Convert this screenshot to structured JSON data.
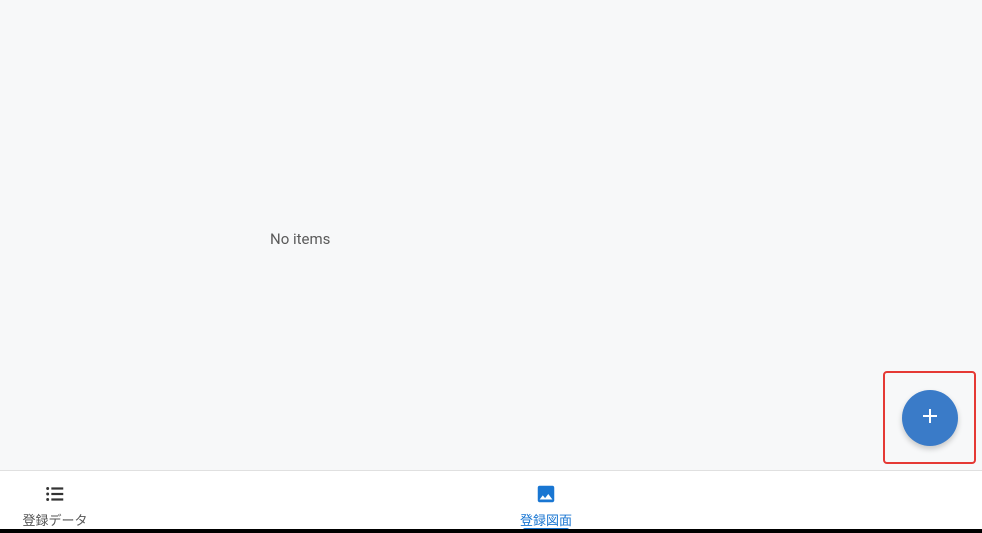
{
  "main": {
    "empty_message": "No items"
  },
  "fab": {
    "icon": "plus-icon",
    "highlighted": true
  },
  "bottom_nav": {
    "items": [
      {
        "label": "登録データ",
        "icon": "list-icon",
        "active": false
      },
      {
        "label": "登録図面",
        "icon": "image-icon",
        "active": true
      }
    ]
  },
  "colors": {
    "accent": "#1976d2",
    "fab_bg": "#3a7bc8",
    "highlight_border": "#e53935"
  }
}
